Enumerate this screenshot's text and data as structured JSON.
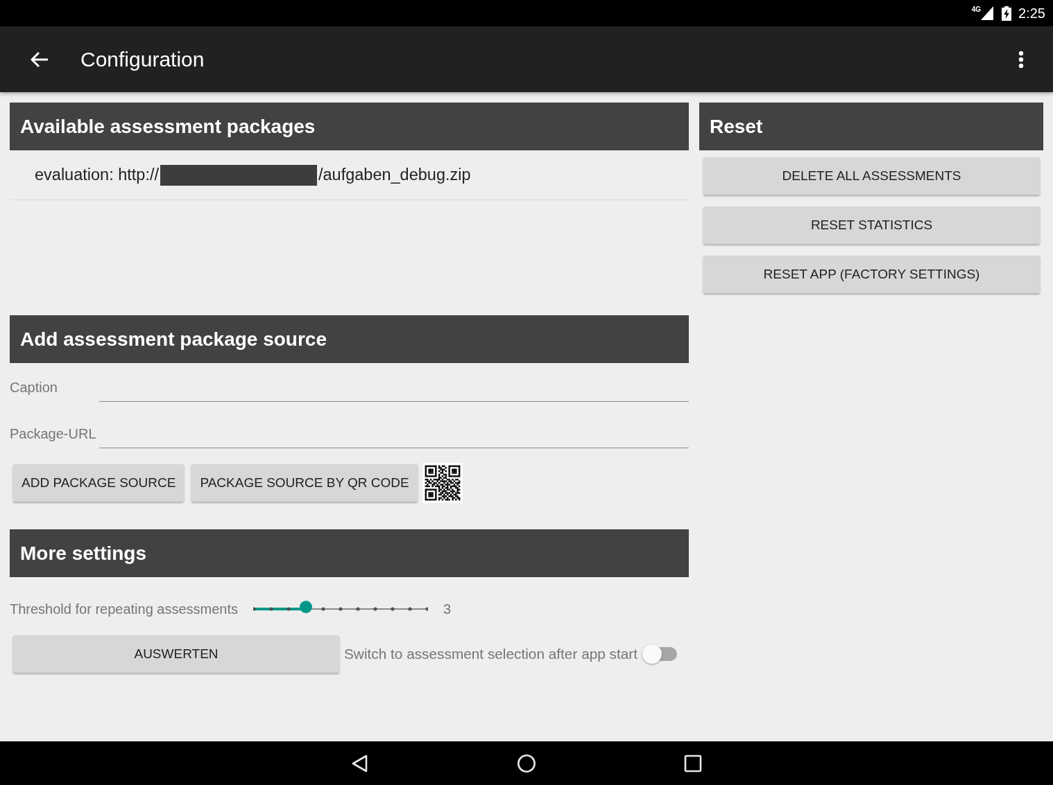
{
  "status_bar": {
    "network": "4G",
    "time": "2:25"
  },
  "app_bar": {
    "title": "Configuration"
  },
  "packages": {
    "title": "Available assessment packages",
    "items": [
      {
        "prefix": "evaluation: http://",
        "redacted": true,
        "suffix": "/aufgaben_debug.zip"
      }
    ]
  },
  "add_source": {
    "title": "Add assessment package source",
    "fields": [
      {
        "label": "Caption"
      },
      {
        "label": "Package-URL"
      }
    ],
    "buttons": [
      "ADD PACKAGE SOURCE",
      "PACKAGE SOURCE BY QR CODE"
    ]
  },
  "more_settings": {
    "title": "More settings",
    "threshold": {
      "label": "Threshold for repeating assessments",
      "level": 0.3,
      "reading": "3"
    },
    "evaluate_button": "AUSWERTEN",
    "startup_switch": {
      "label": "Switch to assessment selection after app start",
      "on": false
    }
  },
  "reset": {
    "title": "Reset",
    "buttons": [
      "DELETE ALL ASSESSMENTS",
      "RESET STATISTICS",
      "RESET APP (FACTORY SETTINGS)"
    ]
  }
}
